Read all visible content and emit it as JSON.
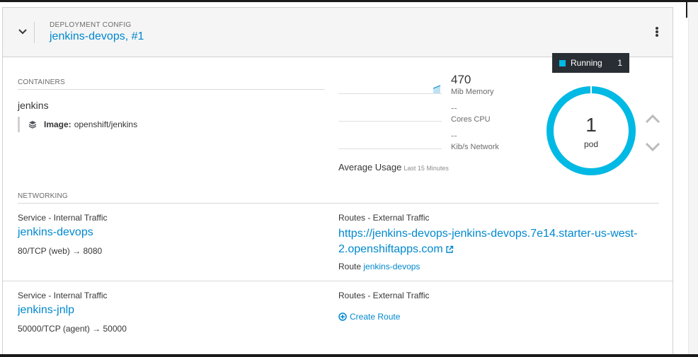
{
  "header": {
    "kind_label": "DEPLOYMENT CONFIG",
    "name": "jenkins-devops",
    "revision": ", #1"
  },
  "containers": {
    "section_label": "CONTAINERS",
    "name": "jenkins",
    "image_label": "Image:",
    "image_value": "openshift/jenkins"
  },
  "metrics": {
    "memory_value": "470",
    "memory_unit": "Mib Memory",
    "cpu_value": "--",
    "cpu_unit": "Cores CPU",
    "network_value": "--",
    "network_unit": "Kib/s Network",
    "avg_label": "Average Usage",
    "avg_range": "Last 15 Minutes"
  },
  "pods": {
    "tooltip_status": "Running",
    "tooltip_count": "1",
    "count": "1",
    "label": "pod",
    "running_fraction": 1.0,
    "color": "#00b9e4"
  },
  "networking": {
    "section_label": "NETWORKING",
    "services": [
      {
        "label": "Service - Internal Traffic",
        "name": "jenkins-devops",
        "ports": "80/TCP (web) → 8080",
        "routes_label": "Routes - External Traffic",
        "route_url": "https://jenkins-devops-jenkins-devops.7e14.starter-us-west-2.openshiftapps.com",
        "route_prefix": "Route",
        "route_name": "jenkins-devops"
      },
      {
        "label": "Service - Internal Traffic",
        "name": "jenkins-jnlp",
        "ports": "50000/TCP (agent) → 50000",
        "routes_label": "Routes - External Traffic",
        "create_route": "Create Route"
      }
    ]
  },
  "colors": {
    "link": "#0088ce",
    "accent": "#00b9e4",
    "header_bg": "#f5f5f5"
  }
}
